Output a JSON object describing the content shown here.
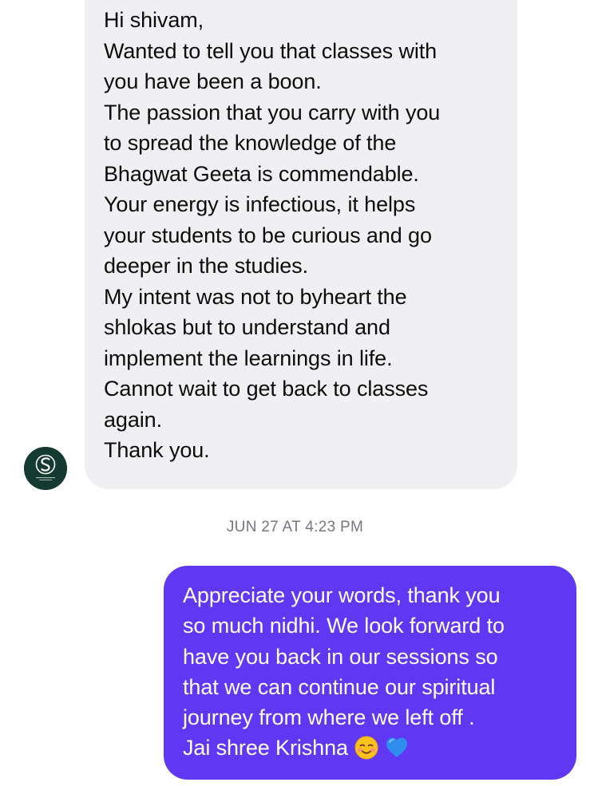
{
  "incoming_message": {
    "lines": [
      "Hi shivam,",
      "Wanted to tell you that classes with",
      "you have been a boon.",
      "The passion that you carry with you",
      "to spread the knowledge of the",
      "Bhagwat Geeta is commendable.",
      "Your energy is infectious, it helps",
      "your students to be curious and go",
      "deeper in the studies.",
      "My intent was not to byheart the",
      "shlokas but to understand and",
      "implement the learnings in life.",
      "Cannot wait to get back to classes",
      "again.",
      "Thank you."
    ],
    "avatar_icon": "sender-logo-icon"
  },
  "timestamp": "JUN 27 AT 4:23 PM",
  "outgoing_message": {
    "lines": [
      "Appreciate your words, thank you",
      "so much nidhi. We look forward to",
      "have you back in our sessions so",
      "that we can continue our spiritual",
      "journey from where we left off .",
      "Jai shree Krishna"
    ],
    "emojis": [
      "smiling-face-icon",
      "blue-heart-icon"
    ]
  },
  "colors": {
    "incoming_bubble": "#f0f0f3",
    "outgoing_bubble": "#6037f2",
    "avatar_background": "#153b31",
    "timestamp_text": "#77777d"
  }
}
